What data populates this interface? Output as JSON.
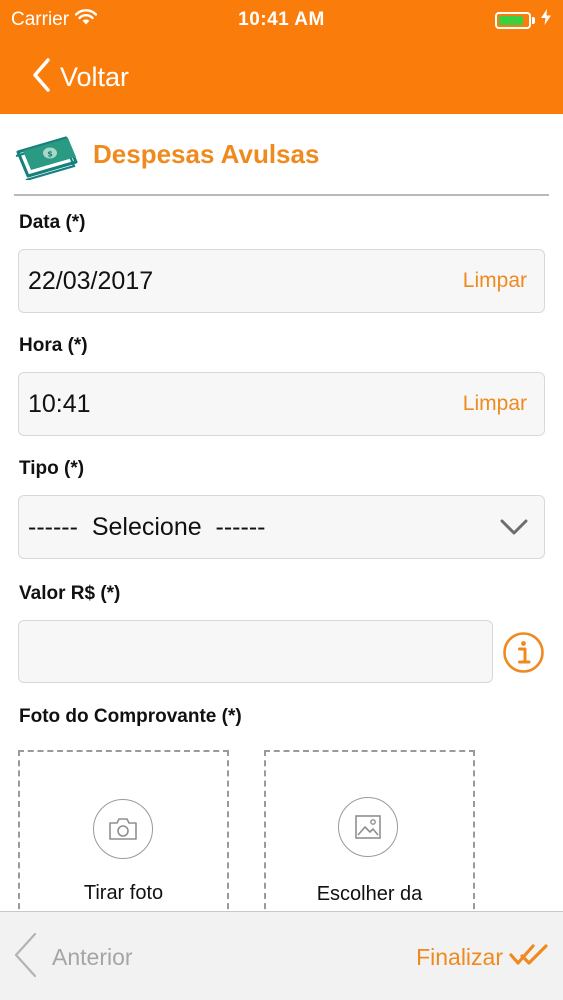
{
  "status_bar": {
    "carrier": "Carrier",
    "time": "10:41 AM"
  },
  "nav": {
    "back_label": "Voltar"
  },
  "header": {
    "title": "Despesas Avulsas"
  },
  "form": {
    "date": {
      "label": "Data (*)",
      "value": "22/03/2017",
      "clear_label": "Limpar"
    },
    "time": {
      "label": "Hora (*)",
      "value": "10:41",
      "clear_label": "Limpar"
    },
    "type": {
      "label": "Tipo (*)",
      "selected": "------  Selecione  ------"
    },
    "amount": {
      "label": "Valor R$ (*)",
      "value": ""
    },
    "receipt_photo": {
      "label": "Foto do Comprovante (*)",
      "take_photo_label": "Tirar foto",
      "choose_label": "Escolher da"
    }
  },
  "bottom_bar": {
    "prev_label": "Anterior",
    "finish_label": "Finalizar"
  },
  "colors": {
    "brand": "#fa7d0b",
    "accent_text": "#ef8a1f",
    "battery": "#3ad040"
  },
  "icons": {
    "status": [
      "wifi-icon",
      "battery-icon",
      "charging-bolt-icon"
    ],
    "nav": [
      "chevron-left-icon"
    ],
    "header": [
      "money-icon"
    ],
    "form": [
      "chevron-down-icon",
      "info-icon",
      "camera-icon",
      "image-icon"
    ],
    "bottom": [
      "chevron-left-icon",
      "double-check-icon"
    ]
  }
}
